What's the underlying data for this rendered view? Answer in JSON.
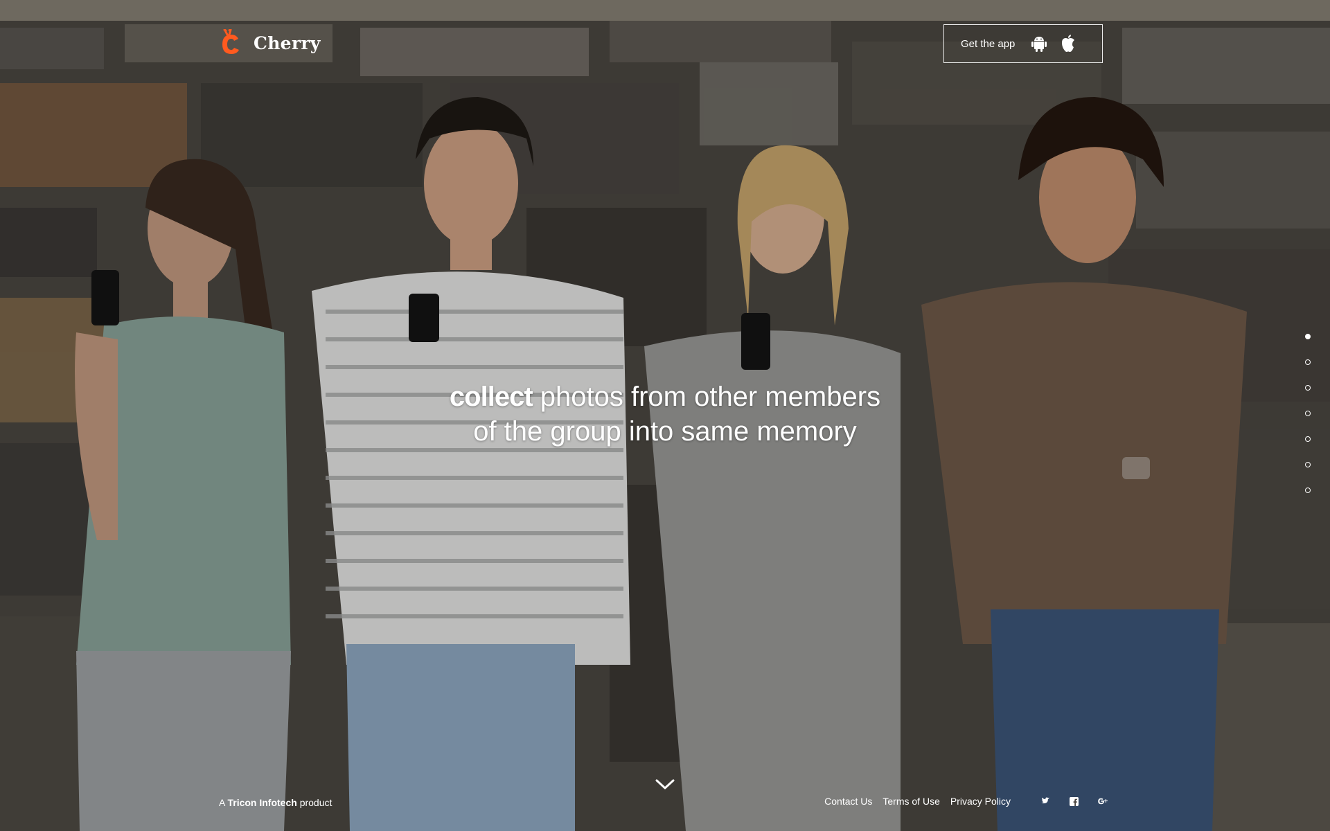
{
  "brand": {
    "name": "Cherry",
    "accent": "#ff5a1f"
  },
  "header": {
    "get_app_label": "Get the app",
    "store_icons": [
      "android-icon",
      "apple-icon"
    ]
  },
  "hero": {
    "highlight": "collect",
    "line1_rest": " photos from other members",
    "line2": "of the group into same memory"
  },
  "pager": {
    "count": 7,
    "active_index": 0
  },
  "footer": {
    "credit_prefix": "A ",
    "credit_company": "Tricon Infotech",
    "credit_suffix": " product",
    "links": [
      "Contact Us",
      "Terms of Use",
      "Privacy Policy"
    ],
    "social_icons": [
      "twitter-icon",
      "facebook-icon",
      "google-plus-icon"
    ]
  }
}
